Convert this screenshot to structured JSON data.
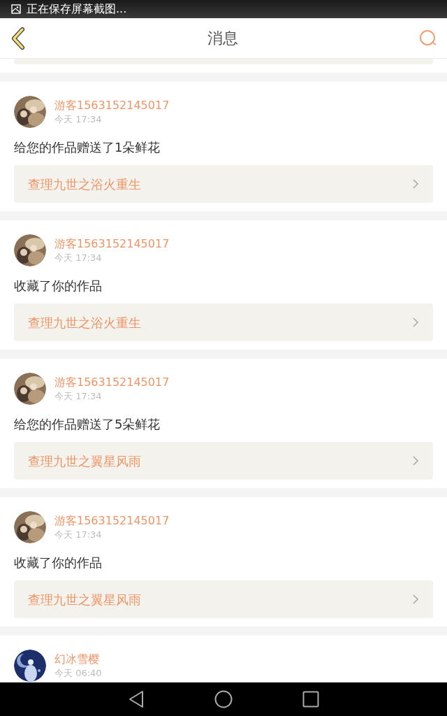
{
  "status_bar": {
    "notification": "正在保存屏幕截图..."
  },
  "header": {
    "title": "消息"
  },
  "messages": [
    {
      "user": "游客1563152145017",
      "time": "今天 17:34",
      "text": "给您的作品赠送了1朵鲜花",
      "link": "查理九世之浴火重生"
    },
    {
      "user": "游客1563152145017",
      "time": "今天 17:34",
      "text": "收藏了你的作品",
      "link": "查理九世之浴火重生"
    },
    {
      "user": "游客1563152145017",
      "time": "今天 17:34",
      "text": "给您的作品赠送了5朵鲜花",
      "link": "查理九世之翼星风雨"
    },
    {
      "user": "游客1563152145017",
      "time": "今天 17:34",
      "text": "收藏了你的作品",
      "link": "查理九世之翼星风雨"
    },
    {
      "user": "幻冰雪樱",
      "time": "今天 06:40"
    }
  ]
}
